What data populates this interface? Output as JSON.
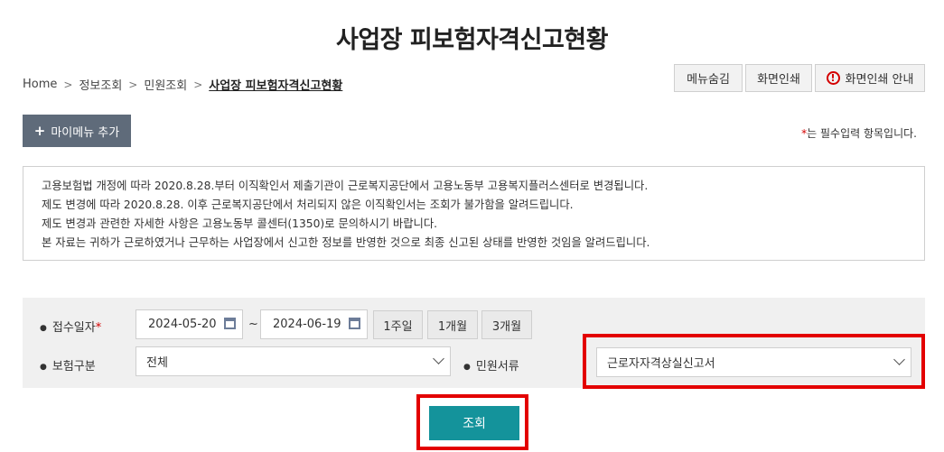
{
  "page": {
    "title": "사업장 피보험자격신고현황"
  },
  "breadcrumb": {
    "items": [
      "Home",
      "정보조회",
      "민원조회"
    ],
    "current": "사업장 피보험자격신고현황"
  },
  "top_buttons": {
    "hide_menu": "메뉴숨김",
    "print": "화면인쇄",
    "print_guide": "화면인쇄 안내"
  },
  "my_menu": {
    "label": "마이메뉴 추가"
  },
  "required_note": {
    "star": "*",
    "text": "는 필수입력 항목입니다."
  },
  "notice": {
    "lines": [
      "고용보험법 개정에 따라 2020.8.28.부터 이직확인서 제출기관이 근로복지공단에서 고용노동부 고용복지플러스센터로 변경됩니다.",
      "제도 변경에 따라 2020.8.28. 이후 근로복지공단에서 처리되지 않은 이직확인서는 조회가 불가함을 알려드립니다.",
      "제도 변경과 관련한 자세한 사항은 고용노동부 콜센터(1350)로 문의하시기 바랍니다.",
      "본 자료는 귀하가 근로하였거나 근무하는 사업장에서 신고한 정보를 반영한 것으로 최종 신고된 상태를 반영한 것임을 알려드립니다."
    ]
  },
  "search": {
    "date_label": "접수일자",
    "date_required": "*",
    "date_from": "2024-05-20",
    "date_sep": "~",
    "date_to": "2024-06-19",
    "periods": [
      "1주일",
      "1개월",
      "3개월"
    ],
    "insurance_label": "보험구분",
    "insurance_value": "전체",
    "doc_label": "민원서류",
    "doc_value": "근로자자격상실신고서",
    "submit": "조회"
  },
  "colors": {
    "highlight": "#e30000",
    "submit": "#14939b",
    "mymenu": "#5f6b7a"
  }
}
